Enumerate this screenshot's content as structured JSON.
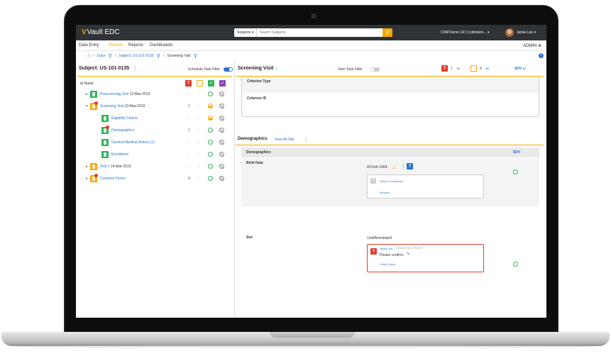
{
  "app": {
    "logo_mark": "V",
    "logo_text": "Vault EDC"
  },
  "topbar": {
    "search_scope": "Subjects ▾",
    "search_placeholder": "Search Subjects",
    "study": "CDM Demo LR 3 (cdmdem...  ▾",
    "user": "Jamie Lee  ▾"
  },
  "nav": {
    "tabs": [
      "Data Entry",
      "Review",
      "Reports",
      "Dashboards"
    ],
    "active": "Review",
    "admin": "ADMIN ⊕"
  },
  "breadcrumb": {
    "home": "⌂",
    "duke": "Duke",
    "subject": "Subject: US-101-0135",
    "visit": "Screening Visit"
  },
  "left": {
    "title": "Subject: US-101-0135",
    "kebab": "⋮",
    "schedule_filter": "Schedule Task Filter",
    "name_header": "⊞ Name",
    "rows": [
      {
        "label": "Prescreening Visit",
        "date": "12-Mar-2019",
        "c1": "-",
        "c2": "-"
      },
      {
        "label": "Screening Visit",
        "date": "13-Mar-2019",
        "c1": "1",
        "c2": "-"
      },
      {
        "label": "Eligibility Criteria",
        "date": "",
        "c1": "-",
        "c2": "-"
      },
      {
        "label": "Demographics",
        "date": "",
        "c1": "1",
        "c2": "-"
      },
      {
        "label": "General Medical History (1)",
        "date": "",
        "c1": "-",
        "c2": "-"
      },
      {
        "label": "Enrollment",
        "date": "",
        "c1": "-",
        "c2": "-"
      },
      {
        "label": "Visit 1",
        "date": "14-Mar-2019",
        "c1": "-",
        "c2": "-"
      },
      {
        "label": "Common Forms",
        "date": "",
        "c1": "9",
        "c2": "-"
      }
    ]
  },
  "right": {
    "title": "Screening Visit",
    "kebab": "⋮",
    "item_filter": "Item Task Filter",
    "query_count": "1",
    "comment_count": "0",
    "sdv": "SDV",
    "criteria": {
      "type_label": "Criterion Type",
      "id_label": "Criterion ID"
    },
    "demographics": {
      "title": "Demographics",
      "view_as_site": "View As Site",
      "grid_header": "Demographics",
      "sdv": "SDV",
      "birth_label": "Birth Date",
      "birth_value": "03-Feb-1964",
      "show_comments": "Show 3 comments",
      "reopen": "Reopen",
      "sex_label": "Sex",
      "sex_value": "Undifferentiated",
      "query_author": "Jamie Lee",
      "query_time": "5/16/2019 5:01 PM EDT",
      "query_text": "Please confirm.",
      "close_query": "Close Query"
    }
  },
  "colors": {
    "accent": "#f7a800",
    "link": "#2a72c9",
    "green": "#2fb45a",
    "red": "#e33b2f",
    "purple": "#8b3fc1",
    "topbar": "#2f3236"
  }
}
